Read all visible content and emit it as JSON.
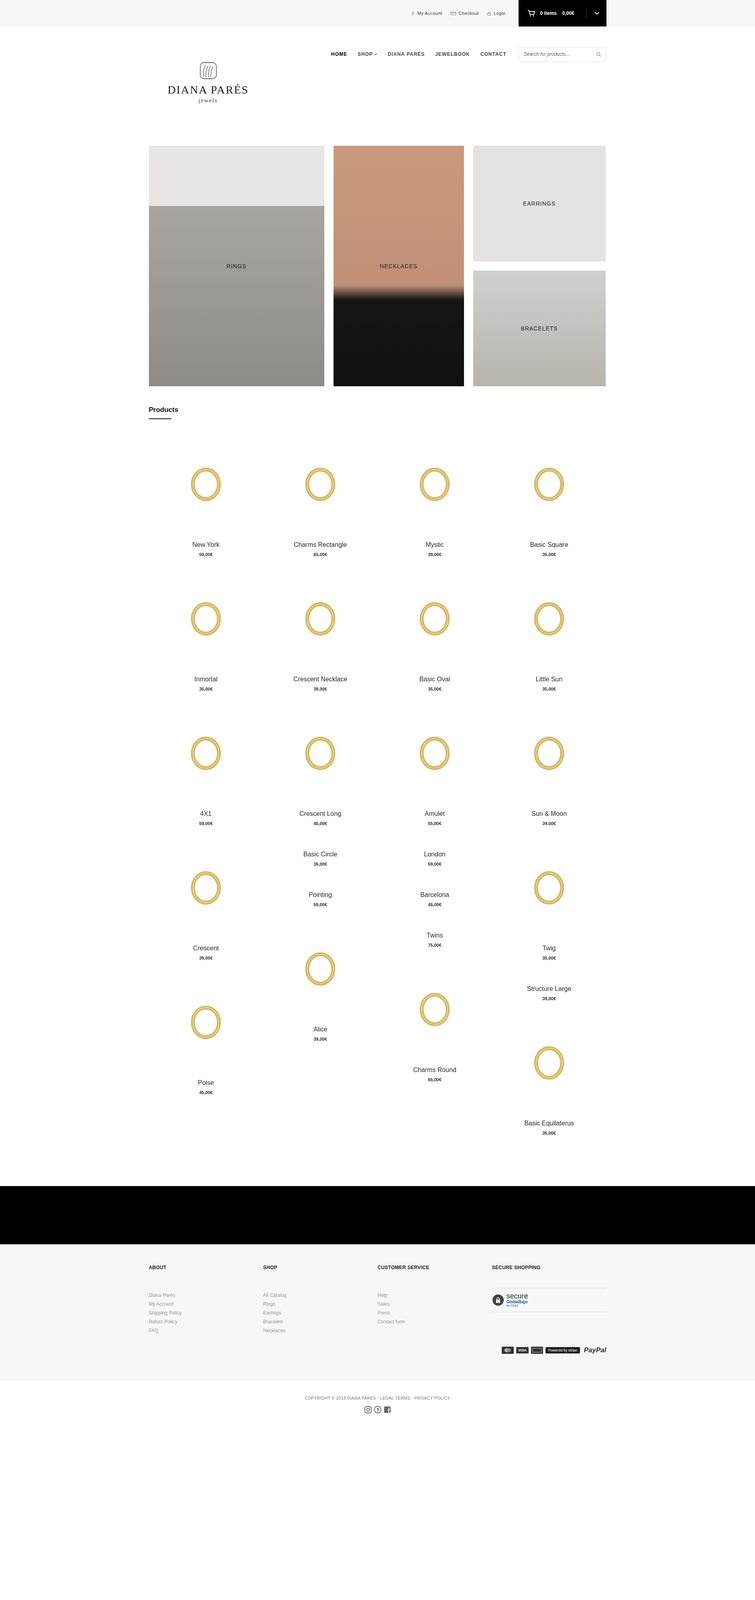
{
  "topbar": {
    "links": [
      {
        "label": "My Account"
      },
      {
        "label": "Checkout"
      },
      {
        "label": "Login"
      }
    ],
    "cart": {
      "count": "0 items",
      "total": "0,00€"
    }
  },
  "logo": {
    "name": "DIANA PARÉS",
    "tagline": "jewels"
  },
  "nav": [
    {
      "label": "HOME",
      "selected": true,
      "has_menu": false
    },
    {
      "label": "SHOP",
      "selected": false,
      "has_menu": true
    },
    {
      "label": "DIANA PARÉS",
      "selected": false,
      "has_menu": false
    },
    {
      "label": "JEWELBOOK",
      "selected": false,
      "has_menu": false
    },
    {
      "label": "CONTACT",
      "selected": false,
      "has_menu": false
    }
  ],
  "search": {
    "placeholder": "Search for products..."
  },
  "categories": [
    {
      "label": "RINGS"
    },
    {
      "label": "NECKLACES"
    },
    {
      "label": "EARRINGS"
    },
    {
      "label": "BRACELETS"
    }
  ],
  "products": {
    "title": "Products",
    "columns": [
      [
        {
          "name": "New York",
          "price": "59,00€",
          "kind": "photo"
        },
        {
          "name": "Inmortal",
          "price": "35,00€",
          "kind": "photo"
        },
        {
          "name": "4X1",
          "price": "59,00€",
          "kind": "photo"
        },
        {
          "name": "Crescent",
          "price": "39,00€",
          "kind": "photo"
        },
        {
          "name": "Poise",
          "price": "45,00€",
          "kind": "photo"
        }
      ],
      [
        {
          "name": "Charms Rectangle",
          "price": "65,00€",
          "kind": "photo"
        },
        {
          "name": "Crescent Necklace",
          "price": "39,00€",
          "kind": "photo"
        },
        {
          "name": "Crescent Long",
          "price": "45,00€",
          "kind": "photo"
        },
        {
          "name": "Basic Circle",
          "price": "35,00€",
          "kind": "text"
        },
        {
          "name": "Pointing",
          "price": "59,00€",
          "kind": "text"
        },
        {
          "name": "Alice",
          "price": "39,00€",
          "kind": "photo"
        }
      ],
      [
        {
          "name": "Mystic",
          "price": "39,00€",
          "kind": "photo"
        },
        {
          "name": "Basic Oval",
          "price": "35,00€",
          "kind": "photo"
        },
        {
          "name": "Amulet",
          "price": "55,00€",
          "kind": "photo"
        },
        {
          "name": "London",
          "price": "59,00€",
          "kind": "text"
        },
        {
          "name": "Barcelona",
          "price": "45,00€",
          "kind": "text"
        },
        {
          "name": "Twins",
          "price": "75,00€",
          "kind": "text"
        },
        {
          "name": "Charms Round",
          "price": "65,00€",
          "kind": "photo"
        }
      ],
      [
        {
          "name": "Basic Square",
          "price": "35,00€",
          "kind": "photo"
        },
        {
          "name": "Little Sun",
          "price": "35,00€",
          "kind": "photo"
        },
        {
          "name": "Sun & Moon",
          "price": "39,00€",
          "kind": "photo"
        },
        {
          "name": "Twig",
          "price": "35,00€",
          "kind": "photo"
        },
        {
          "name": "Structure Large",
          "price": "39,00€",
          "kind": "text"
        },
        {
          "name": "Basic Equilaterus",
          "price": "35,00€",
          "kind": "photo"
        }
      ]
    ]
  },
  "footer": {
    "columns": [
      {
        "title": "ABOUT",
        "links": [
          "Diana Parés",
          "My Account",
          "Shipping Policy",
          "Return Policy",
          "FAQ"
        ]
      },
      {
        "title": "SHOP",
        "links": [
          "All Catalog",
          "Rings",
          "Earrings",
          "Bracelets",
          "Necklaces"
        ]
      },
      {
        "title": "CUSTOMER SERVICE",
        "links": [
          "Help",
          "Sales",
          "Press",
          "Contact form"
        ]
      }
    ],
    "secure": {
      "title": "SECURE SHOPPING",
      "main": "secure",
      "brand": "GlobalSign",
      "sub": "by GMO"
    },
    "payments": [
      {
        "kind": "mastercard",
        "label": ""
      },
      {
        "kind": "card",
        "label": "VISA"
      },
      {
        "kind": "blank",
        "label": ""
      },
      {
        "kind": "stripe",
        "label": "Powered by stripe"
      },
      {
        "kind": "paypal",
        "label": "PayPal"
      }
    ]
  },
  "copyright": "COPYRIGHT © 2018 DIANA PARES · LEGAL TERMS · PRIVACY POLICY"
}
